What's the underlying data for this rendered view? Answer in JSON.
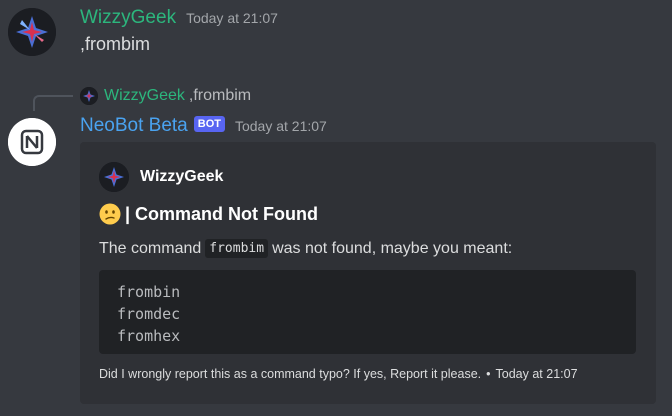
{
  "colors": {
    "background": "#36393f",
    "username": "#2cb67d",
    "botname": "#4aa3f0",
    "bot_tag": "#5865f2",
    "embed_bg": "#2f3136",
    "code_bg": "#202225"
  },
  "message1": {
    "username": "WizzyGeek",
    "timestamp": "Today at 21:07",
    "text": ",frombim",
    "avatar_icon": "wizzygeek-avatar-icon"
  },
  "reply": {
    "username": "WizzyGeek",
    "text": ",frombim"
  },
  "message2": {
    "username": "NeoBot Beta",
    "bot_tag": "BOT",
    "timestamp": "Today at 21:07",
    "avatar_icon": "neobot-logo-icon",
    "embed": {
      "author": "WizzyGeek",
      "title_emoji": "confused-face-icon",
      "title": "| Command Not Found",
      "description_prefix": "The command",
      "description_code": "frombim",
      "description_suffix": "was not found, maybe you meant:",
      "suggestions": [
        "frombin",
        "fromdec",
        "fromhex"
      ],
      "footer_text": "Did I wrongly report this as a command typo? If yes, Report it please.",
      "footer_separator": "•",
      "footer_timestamp": "Today at 21:07"
    }
  }
}
